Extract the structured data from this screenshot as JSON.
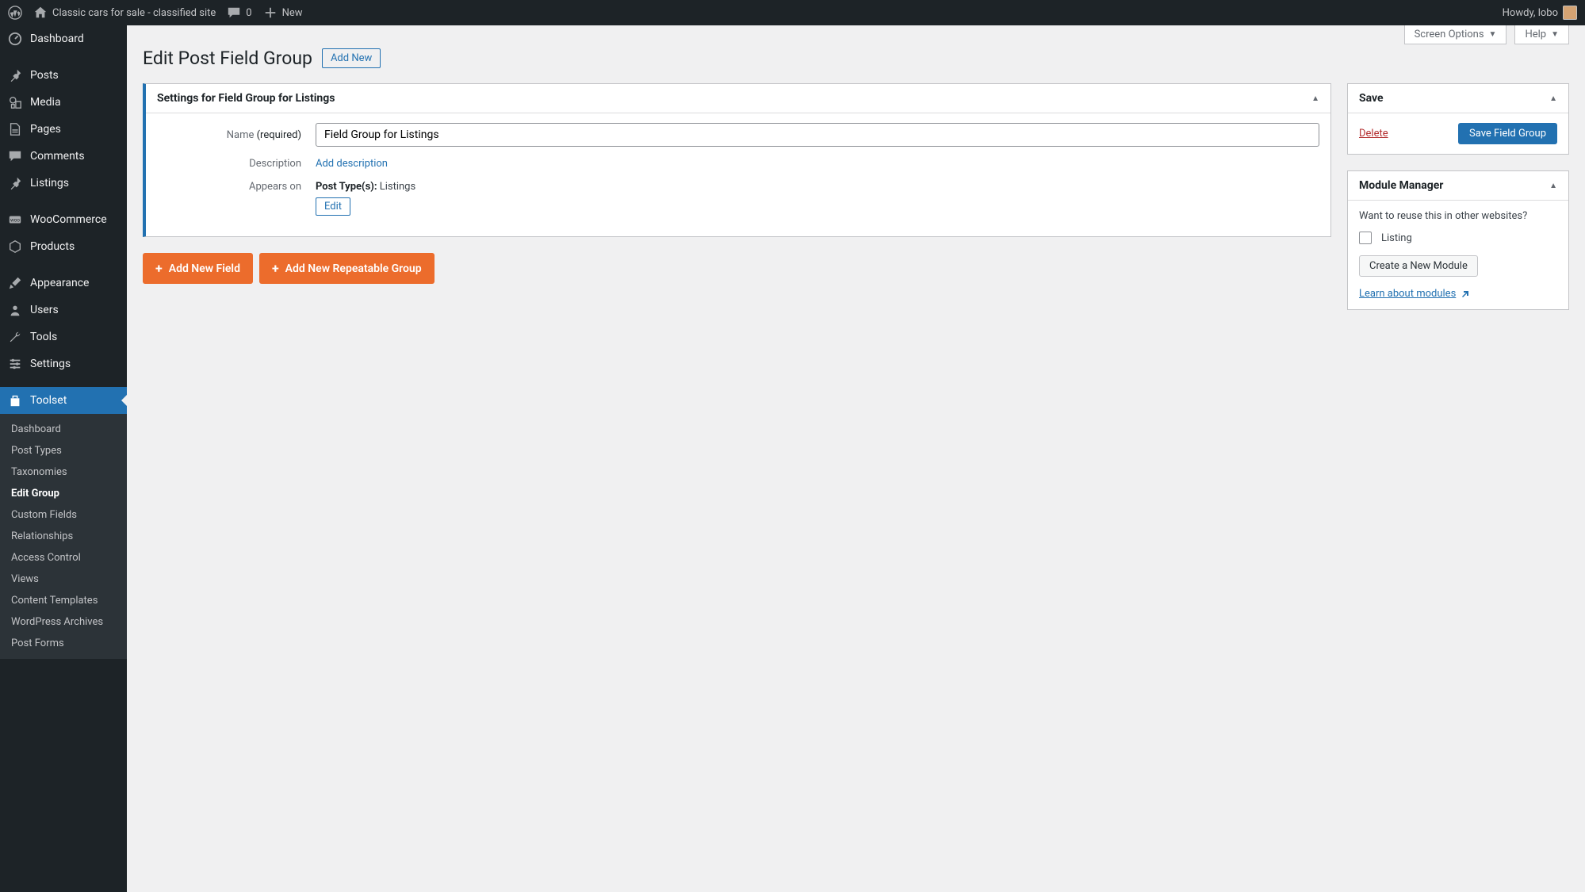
{
  "adminbar": {
    "site_name": "Classic cars for sale - classified site",
    "comments_count": "0",
    "new_label": "New",
    "greeting": "Howdy, lobo"
  },
  "sidebar": {
    "items": [
      {
        "label": "Dashboard",
        "icon": "dashboard"
      },
      {
        "label": "Posts",
        "icon": "pin"
      },
      {
        "label": "Media",
        "icon": "media"
      },
      {
        "label": "Pages",
        "icon": "pages"
      },
      {
        "label": "Comments",
        "icon": "comment"
      },
      {
        "label": "Listings",
        "icon": "pin"
      },
      {
        "label": "WooCommerce",
        "icon": "woo"
      },
      {
        "label": "Products",
        "icon": "product"
      },
      {
        "label": "Appearance",
        "icon": "brush"
      },
      {
        "label": "Users",
        "icon": "user"
      },
      {
        "label": "Tools",
        "icon": "wrench"
      },
      {
        "label": "Settings",
        "icon": "sliders"
      },
      {
        "label": "Toolset",
        "icon": "toolset",
        "active": true
      }
    ],
    "submenu": [
      "Dashboard",
      "Post Types",
      "Taxonomies",
      "Edit Group",
      "Custom Fields",
      "Relationships",
      "Access Control",
      "Views",
      "Content Templates",
      "WordPress Archives",
      "Post Forms"
    ],
    "current_sub": "Edit Group"
  },
  "toptabs": {
    "screen_options": "Screen Options",
    "help": "Help"
  },
  "page": {
    "title": "Edit Post Field Group",
    "add_new": "Add New"
  },
  "settings_panel": {
    "title": "Settings for Field Group for Listings",
    "name_label": "Name",
    "required": "(required)",
    "name_value": "Field Group for Listings",
    "description_label": "Description",
    "add_description": "Add description",
    "appears_label": "Appears on",
    "post_types_label": "Post Type(s):",
    "post_types_value": "Listings",
    "edit_btn": "Edit"
  },
  "buttons": {
    "add_field": "Add New Field",
    "add_group": "Add New Repeatable Group"
  },
  "save_panel": {
    "title": "Save",
    "delete": "Delete",
    "save": "Save Field Group"
  },
  "module_panel": {
    "title": "Module Manager",
    "intro": "Want to reuse this in other websites?",
    "checkbox_label": "Listing",
    "create_btn": "Create a New Module",
    "learn": "Learn about modules"
  }
}
